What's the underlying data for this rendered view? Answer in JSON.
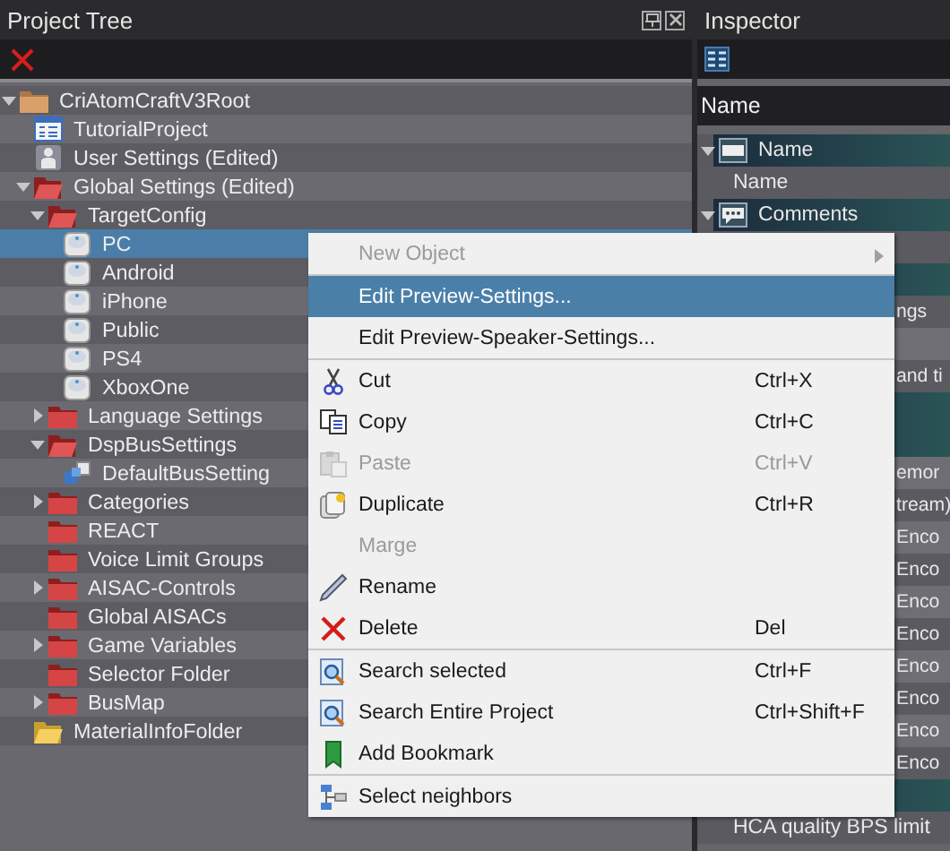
{
  "project_tree": {
    "title": "Project Tree",
    "nodes": [
      {
        "label": "CriAtomCraftV3Root",
        "kind": "root",
        "expanded": true,
        "selected": false,
        "children": [
          {
            "label": "TutorialProject",
            "kind": "project",
            "selected": false
          },
          {
            "label": "User Settings (Edited)",
            "kind": "user",
            "selected": false
          },
          {
            "label": "Global Settings (Edited)",
            "kind": "folder",
            "expanded": true,
            "selected": false,
            "children": [
              {
                "label": "TargetConfig",
                "kind": "folder",
                "expanded": true,
                "selected": false,
                "children": [
                  {
                    "label": "PC",
                    "kind": "target",
                    "selected": true
                  },
                  {
                    "label": "Android",
                    "kind": "target",
                    "selected": false
                  },
                  {
                    "label": "iPhone",
                    "kind": "target",
                    "selected": false
                  },
                  {
                    "label": "Public",
                    "kind": "target",
                    "selected": false
                  },
                  {
                    "label": "PS4",
                    "kind": "target",
                    "selected": false
                  },
                  {
                    "label": "XboxOne",
                    "kind": "target",
                    "selected": false
                  }
                ]
              },
              {
                "label": "Language Settings",
                "kind": "folder",
                "expanded": false,
                "selected": false
              },
              {
                "label": "DspBusSettings",
                "kind": "folder",
                "expanded": true,
                "selected": false,
                "children": [
                  {
                    "label": "DefaultBusSetting",
                    "kind": "bus",
                    "selected": false
                  }
                ]
              },
              {
                "label": "Categories",
                "kind": "folder",
                "expanded": false,
                "selected": false
              },
              {
                "label": "REACT",
                "kind": "folder",
                "selected": false
              },
              {
                "label": "Voice Limit Groups",
                "kind": "folder",
                "selected": false
              },
              {
                "label": "AISAC-Controls",
                "kind": "folder",
                "expanded": false,
                "selected": false
              },
              {
                "label": "Global AISACs",
                "kind": "folder",
                "selected": false
              },
              {
                "label": "Game Variables",
                "kind": "folder",
                "expanded": false,
                "selected": false
              },
              {
                "label": "Selector Folder",
                "kind": "folder",
                "selected": false
              },
              {
                "label": "BusMap",
                "kind": "folder",
                "expanded": false,
                "selected": false
              }
            ]
          },
          {
            "label": "MaterialInfoFolder",
            "kind": "material",
            "selected": false
          }
        ]
      }
    ]
  },
  "inspector": {
    "title": "Inspector",
    "column": "Name",
    "rows": [
      {
        "kind": "group",
        "text": "Name"
      },
      {
        "kind": "property",
        "text": "Name"
      },
      {
        "kind": "group",
        "text": "Comments"
      },
      {
        "kind": "covered"
      },
      {
        "kind": "group"
      },
      {
        "kind": "covered",
        "text": "ngs"
      },
      {
        "kind": "covered"
      },
      {
        "kind": "covered",
        "text": "and ti"
      },
      {
        "kind": "group"
      },
      {
        "kind": "group"
      },
      {
        "kind": "covered",
        "text": "emor"
      },
      {
        "kind": "covered",
        "text": "tream)"
      },
      {
        "kind": "covered",
        "text": "Enco"
      },
      {
        "kind": "covered",
        "text": "Enco"
      },
      {
        "kind": "covered",
        "text": "Enco"
      },
      {
        "kind": "covered",
        "text": "Enco"
      },
      {
        "kind": "covered",
        "text": "Enco"
      },
      {
        "kind": "covered",
        "text": "Enco"
      },
      {
        "kind": "covered",
        "text": "Enco"
      },
      {
        "kind": "covered",
        "text": "Enco"
      },
      {
        "kind": "group"
      },
      {
        "kind": "property",
        "text": "HCA quality BPS limit"
      }
    ]
  },
  "context_menu": {
    "items": [
      {
        "kind": "command",
        "label": "New Object",
        "disabled": true,
        "selected": false,
        "submenu": true
      },
      {
        "kind": "separator"
      },
      {
        "kind": "command",
        "label": "Edit Preview-Settings...",
        "disabled": false,
        "selected": true
      },
      {
        "kind": "command",
        "label": "Edit Preview-Speaker-Settings...",
        "disabled": false,
        "selected": false
      },
      {
        "kind": "separator"
      },
      {
        "kind": "command",
        "label": "Cut",
        "shortcut": "Ctrl+X",
        "disabled": false,
        "selected": false
      },
      {
        "kind": "command",
        "label": "Copy",
        "shortcut": "Ctrl+C",
        "disabled": false,
        "selected": false
      },
      {
        "kind": "command",
        "label": "Paste",
        "shortcut": "Ctrl+V",
        "disabled": true,
        "selected": false
      },
      {
        "kind": "command",
        "label": "Duplicate",
        "shortcut": "Ctrl+R",
        "disabled": false,
        "selected": false
      },
      {
        "kind": "command",
        "label": "Marge",
        "disabled": true,
        "selected": false
      },
      {
        "kind": "command",
        "label": "Rename",
        "disabled": false,
        "selected": false
      },
      {
        "kind": "command",
        "label": "Delete",
        "shortcut": "Del",
        "disabled": false,
        "selected": false
      },
      {
        "kind": "separator"
      },
      {
        "kind": "command",
        "label": "Search selected",
        "shortcut": "Ctrl+F",
        "disabled": false,
        "selected": false
      },
      {
        "kind": "command",
        "label": "Search Entire Project",
        "shortcut": "Ctrl+Shift+F",
        "disabled": false,
        "selected": false
      },
      {
        "kind": "command",
        "label": "Add Bookmark",
        "disabled": false,
        "selected": false
      },
      {
        "kind": "separator"
      },
      {
        "kind": "command",
        "label": "Select neighbors",
        "disabled": false,
        "selected": false
      }
    ]
  }
}
